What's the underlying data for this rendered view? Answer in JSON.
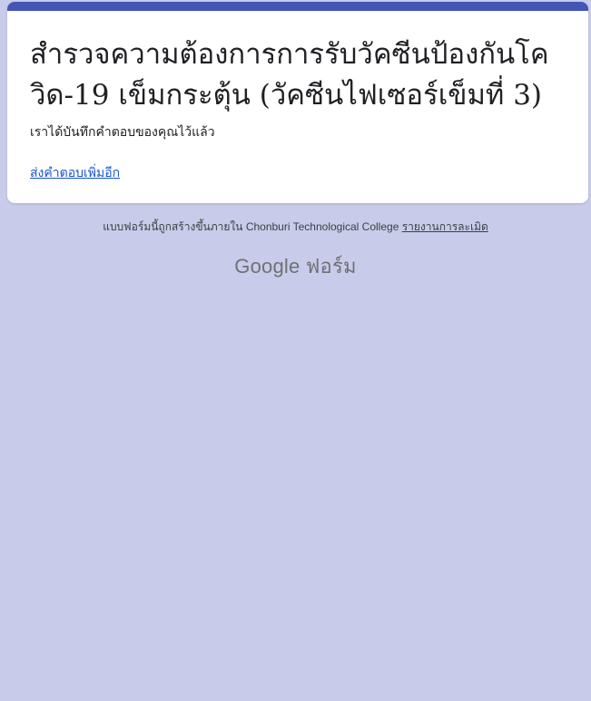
{
  "form": {
    "title": "สำรวจความต้องการการรับวัคซีนป้องกันโควิด-19 เข็มกระตุ้น (วัคซีนไฟเซอร์เข็มที่ 3)",
    "confirmation": "เราได้บันทึกคำตอบของคุณไว้แล้ว",
    "submit_another_link": "ส่งคำตอบเพิ่มอีก"
  },
  "footer": {
    "created_in": "แบบฟอร์มนี้ถูกสร้างขึ้นภายใน Chonburi Technological College",
    "report_link": "รายงานการละเมิด",
    "brand_google": "Google",
    "brand_forms": "ฟอร์ม"
  },
  "colors": {
    "background": "#c9cbea",
    "accent": "#4355b5",
    "link": "#1a55d0"
  }
}
